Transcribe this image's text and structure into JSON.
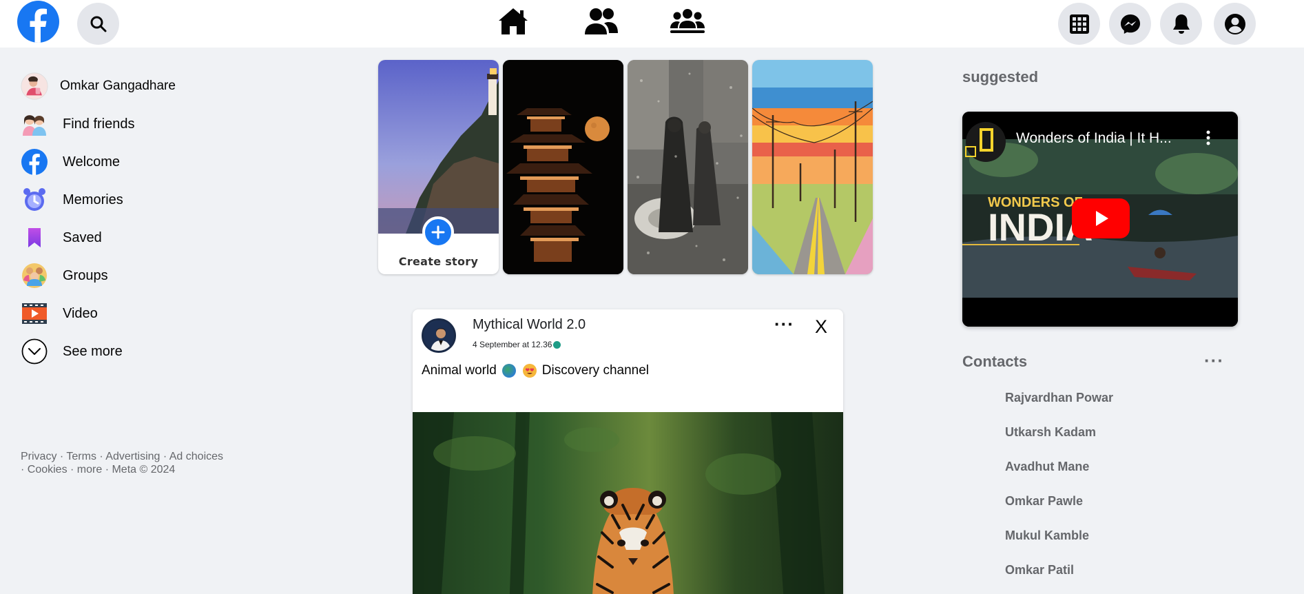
{
  "header": {
    "logo_icon": "facebook-logo-icon",
    "search_icon": "search-icon",
    "nav_icons": [
      "home-icon",
      "friends-icon",
      "groups-icon"
    ],
    "right_icons": [
      "menu-grid-icon",
      "messenger-icon",
      "notifications-icon",
      "account-icon"
    ]
  },
  "sidebar": {
    "profile_name": "Omkar Gangadhare",
    "items": [
      {
        "label": "Find friends",
        "icon": "friends-icon"
      },
      {
        "label": "Welcome",
        "icon": "facebook-icon"
      },
      {
        "label": "Memories",
        "icon": "memories-clock-icon"
      },
      {
        "label": "Saved",
        "icon": "bookmark-icon"
      },
      {
        "label": "Groups",
        "icon": "groups-icon"
      },
      {
        "label": "Video",
        "icon": "video-icon"
      },
      {
        "label": "See more",
        "icon": "chevron-down-icon"
      }
    ],
    "footer_line1": "Privacy · Terms · Advertising · Ad choices",
    "footer_line2": "· Cookies · more · Meta © 2024"
  },
  "stories": {
    "create_label": "Create story"
  },
  "post": {
    "author": "Mythical World 2.0",
    "date": "4 September at 12.36",
    "text_part1": "Animal world",
    "text_part2": "Discovery channel",
    "more_label": "···",
    "close_label": "X"
  },
  "right": {
    "suggested_title": "suggested",
    "video_title": "Wonders of India | It H...",
    "video_overlay_word1": "WONDERS OF",
    "video_overlay_word2": "INDIA",
    "contacts_title": "Contacts",
    "contacts_more": "···",
    "contacts": [
      "Rajvardhan Powar",
      "Utkarsh Kadam",
      "Avadhut Mane",
      "Omkar Pawle",
      "Mukul Kamble",
      "Omkar Patil"
    ]
  },
  "colors": {
    "brand": "#1877f2",
    "background": "#f0f2f5",
    "youtube_red": "#ff0000"
  }
}
